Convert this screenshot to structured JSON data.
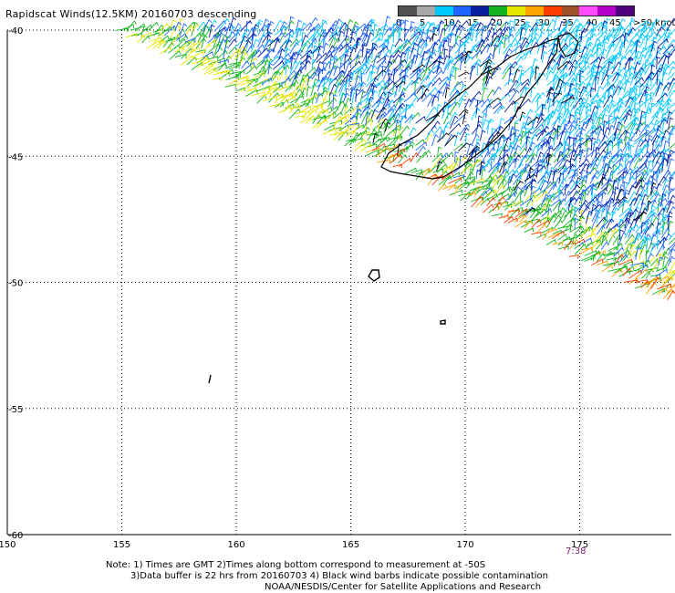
{
  "title": "Rapidscat Winds(12.5KM) 20160703 descending",
  "legend": {
    "ticks": [
      "0",
      "5",
      "10",
      "15",
      "20",
      "25",
      "30",
      "35",
      "40",
      "45",
      ">50 knots"
    ],
    "colors": [
      "#505050",
      "#a8a8a8",
      "#00c8ff",
      "#1e64ff",
      "#0a1ea0",
      "#12b41e",
      "#e6e600",
      "#ffa500",
      "#ff3c00",
      "#a05028",
      "#ff4bff",
      "#b400c8",
      "#50007d"
    ]
  },
  "map": {
    "lon_ticks": [
      "150",
      "155",
      "160",
      "165",
      "170",
      "175"
    ],
    "lat_ticks": [
      "-40",
      "-45",
      "-50",
      "-55",
      "-60"
    ],
    "lon_range": [
      150,
      179
    ],
    "lat_range": [
      -60,
      -40
    ]
  },
  "time_label": "7:38",
  "notes": {
    "line1": "Note: 1) Times are GMT 2)Times along bottom correspond to measurement at -50S",
    "line2": "3)Data buffer is 22 hrs from 20160703 4) Black wind barbs indicate possible contamination",
    "line3": "NOAA/NESDIS/Center for Satellite Applications and Research"
  }
}
